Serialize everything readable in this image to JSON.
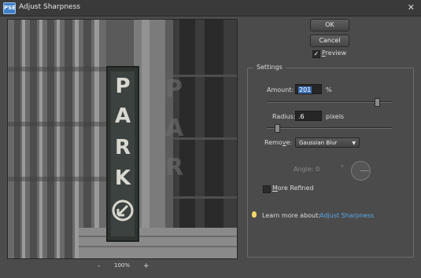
{
  "window": {
    "title": "Adjust Sharpness",
    "app_icon_text": "PSE",
    "close_glyph": "✕"
  },
  "preview": {
    "sign_letters": [
      "P",
      "A",
      "R",
      "K"
    ],
    "zoom_minus": "-",
    "zoom_level": "100%",
    "zoom_plus": "+"
  },
  "buttons": {
    "ok": "OK",
    "cancel": "Cancel"
  },
  "preview_toggle": {
    "label_underlined": "P",
    "label_rest": "review",
    "checked": true,
    "check_glyph": "✓"
  },
  "settings": {
    "legend": "Settings",
    "amount": {
      "label": "Amount:",
      "value": "201",
      "unit": "%",
      "slider_fraction": 0.88
    },
    "radius": {
      "label": "Radius:",
      "value": ".6",
      "unit": "pixels",
      "slider_fraction": 0.08
    },
    "remove": {
      "label_pre": "Remo",
      "label_underlined": "v",
      "label_post": "e:",
      "selected": "Gaussian Blur",
      "arrow": "▼"
    },
    "angle": {
      "label": "Angle:",
      "value": "0",
      "unit": "°"
    },
    "more_refined": {
      "label_underlined": "M",
      "label_rest": "ore Refined",
      "checked": false
    },
    "learn_more": {
      "text": "Learn more about:",
      "link": "Adjust Sharpness"
    }
  },
  "colors": {
    "background": "#4b4b4b",
    "link": "#5aa7e8",
    "selection": "#3d6fb5"
  }
}
